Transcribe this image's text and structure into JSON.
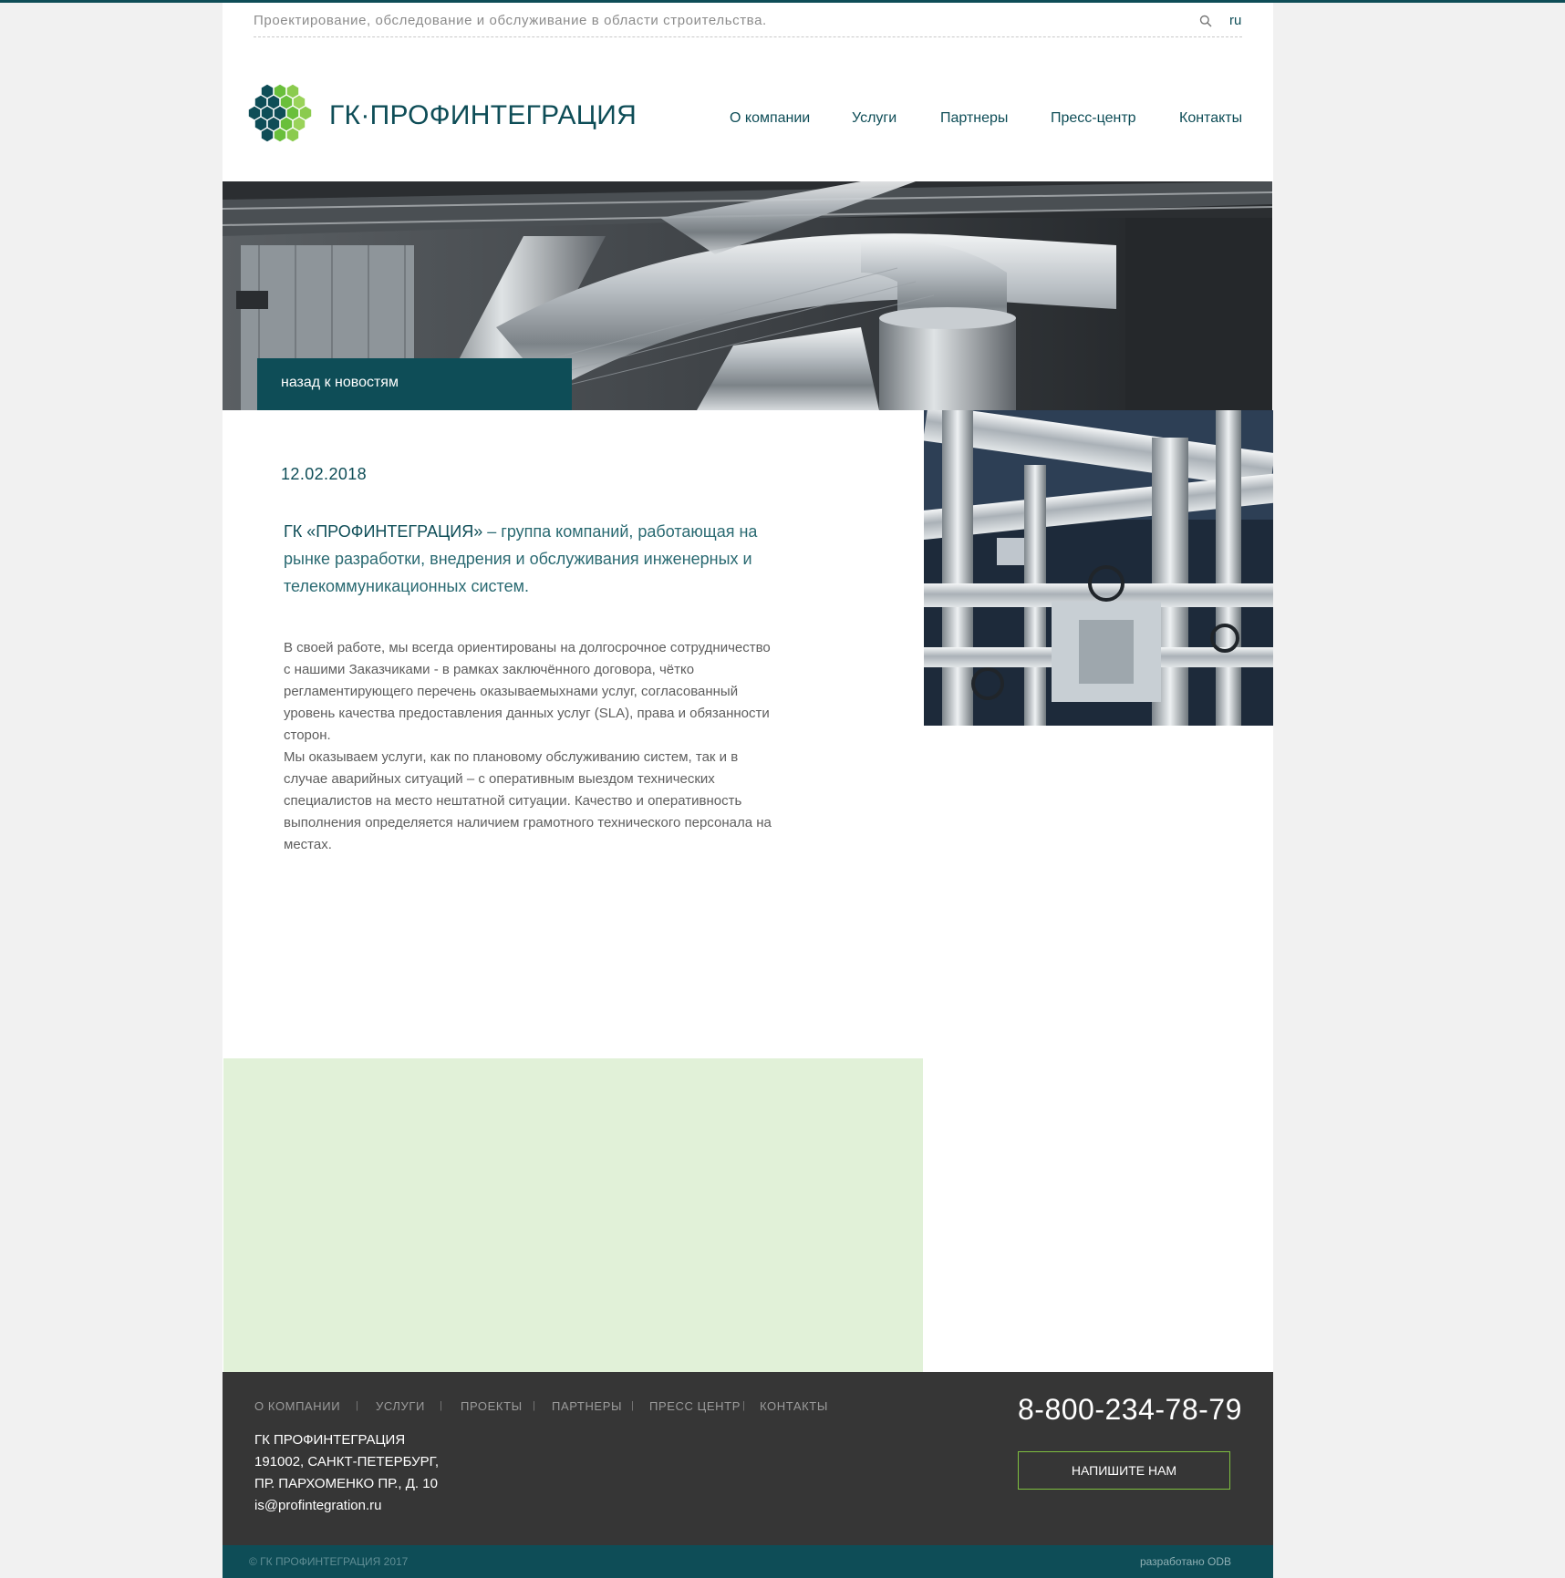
{
  "topbar": {
    "tagline": "Проектирование, обследование и обслуживание в области строительства.",
    "lang": "ru"
  },
  "brand": {
    "name": "ГК·ПРОФИНТЕГРАЦИЯ"
  },
  "nav": [
    "О компании",
    "Услуги",
    "Партнеры",
    "Пресс-центр",
    "Контакты"
  ],
  "banner": {
    "back_label": "назад к новостям"
  },
  "article": {
    "date": "12.02.2018",
    "lead_company": "ГК «ПРОФИНТЕГРАЦИЯ»",
    "lead_rest": " – группа компаний, работающая на рынке разработки, внедрения и обслуживания инженерных и телекоммуникационных систем.",
    "paragraph1": "В своей работе, мы всегда ориентированы на долгосрочное сотрудничество с нашими Заказчиками - в рамках заключённого договора, чётко регламентирующего перечень оказываемыхнами услуг, согласованный уровень качества предоставления данных услуг (SLA), права и обязанности сторон.",
    "paragraph2": "Мы оказываем услуги, как по плановому обслуживанию систем, так и в случае аварийных ситуаций – с оперативным выездом технических специалистов на место нештатной ситуации. Качество и оперативность выполнения определяется наличием грамотного технического персонала на местах."
  },
  "footer": {
    "nav": [
      "О КОМПАНИИ",
      "УСЛУГИ",
      "ПРОЕКТЫ",
      "ПАРТНЕРЫ",
      "ПРЕСС ЦЕНТР",
      "КОНТАКТЫ"
    ],
    "separator": "|",
    "address": [
      "ГК ПРОФИНТЕГРАЦИЯ",
      "191002, САНКТ-ПЕТЕРБУРГ,",
      "ПР. ПАРХОМЕНКО ПР., Д. 10",
      "is@profintegration.ru"
    ],
    "phone": "8-800-234-78-79",
    "write_label": "НАПИШИТЕ НАМ",
    "copyright": "© ГК ПРОФИНТЕГРАЦИЯ 2017",
    "developer": "разработано ODB"
  },
  "colors": {
    "brand": "#0e4d57",
    "accent_green": "#7fbf3f",
    "light_green": "#e1f1d8",
    "footer_bg": "#363636"
  },
  "icons": [
    "search-icon",
    "logo-hexagons-icon"
  ]
}
